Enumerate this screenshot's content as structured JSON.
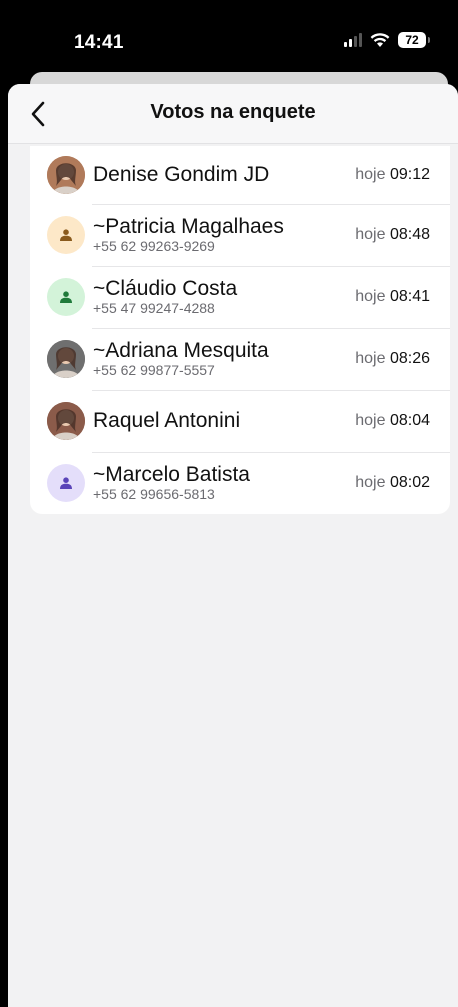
{
  "status": {
    "time": "14:41",
    "battery": "72"
  },
  "nav": {
    "title": "Votos na enquete"
  },
  "voters": [
    {
      "name": "Denise Gondim JD",
      "phone": "",
      "day": "hoje",
      "time": "09:12",
      "avatar": "photo-avatar",
      "color": "#b07a5a"
    },
    {
      "name": "~Patricia Magalhaes",
      "phone": "+55 62 99263-9269",
      "day": "hoje",
      "time": "08:48",
      "avatar": "person-icon",
      "color": "#fde8c8",
      "fg": "#8a5a1c"
    },
    {
      "name": "~Cláudio Costa",
      "phone": "+55 47 99247-4288",
      "day": "hoje",
      "time": "08:41",
      "avatar": "person-icon",
      "color": "#d3f3d9",
      "fg": "#1f7a3a"
    },
    {
      "name": "~Adriana Mesquita",
      "phone": "+55 62 99877-5557",
      "day": "hoje",
      "time": "08:26",
      "avatar": "photo-avatar",
      "color": "#6f6f6f"
    },
    {
      "name": "Raquel Antonini",
      "phone": "",
      "day": "hoje",
      "time": "08:04",
      "avatar": "photo-avatar",
      "color": "#8b5b4a"
    },
    {
      "name": "~Marcelo Batista",
      "phone": "+55 62 99656-5813",
      "day": "hoje",
      "time": "08:02",
      "avatar": "person-icon",
      "color": "#e4defa",
      "fg": "#5a44b8"
    }
  ]
}
